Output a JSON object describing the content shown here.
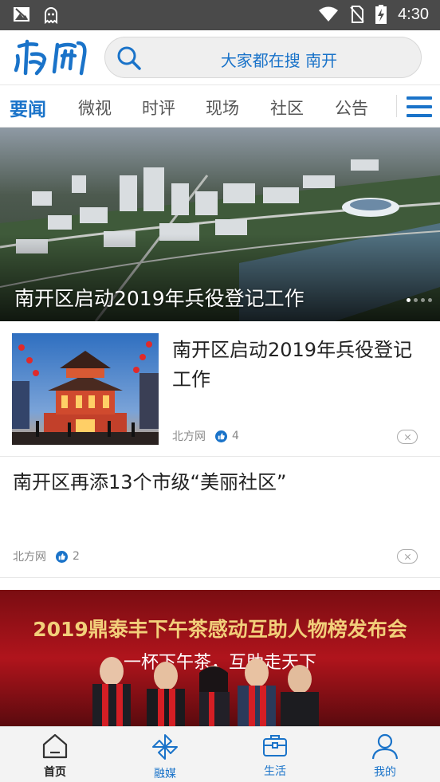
{
  "status_bar": {
    "time": "4:30"
  },
  "header": {
    "logo_text": "南开",
    "search_placeholder": "大家都在搜 南开"
  },
  "tabs": [
    {
      "label": "要闻",
      "active": true
    },
    {
      "label": "微视"
    },
    {
      "label": "时评"
    },
    {
      "label": "现场"
    },
    {
      "label": "社区"
    },
    {
      "label": "公告"
    }
  ],
  "banner": {
    "caption": "南开区启动2019年兵役登记工作",
    "slide_count": 4,
    "active_slide": 1
  },
  "news": [
    {
      "title": "南开区启动2019年兵役登记工作",
      "source": "北方网",
      "likes": "4"
    },
    {
      "title": "南开区再添13个市级“美丽社区”",
      "source": "北方网",
      "likes": "2"
    }
  ],
  "banner2": {
    "text_line1": "2019鼎泰丰下午茶感动互助人物榜发布会",
    "text_line2": "一杯下午茶，互助走天下"
  },
  "bottom_nav": [
    {
      "label": "首页",
      "icon": "home-icon",
      "active": true
    },
    {
      "label": "融媒",
      "icon": "pinwheel-icon"
    },
    {
      "label": "生活",
      "icon": "briefcase-icon"
    },
    {
      "label": "我的",
      "icon": "person-icon"
    }
  ],
  "colors": {
    "accent": "#1a73c9",
    "status_bar": "#4a4a4a"
  }
}
